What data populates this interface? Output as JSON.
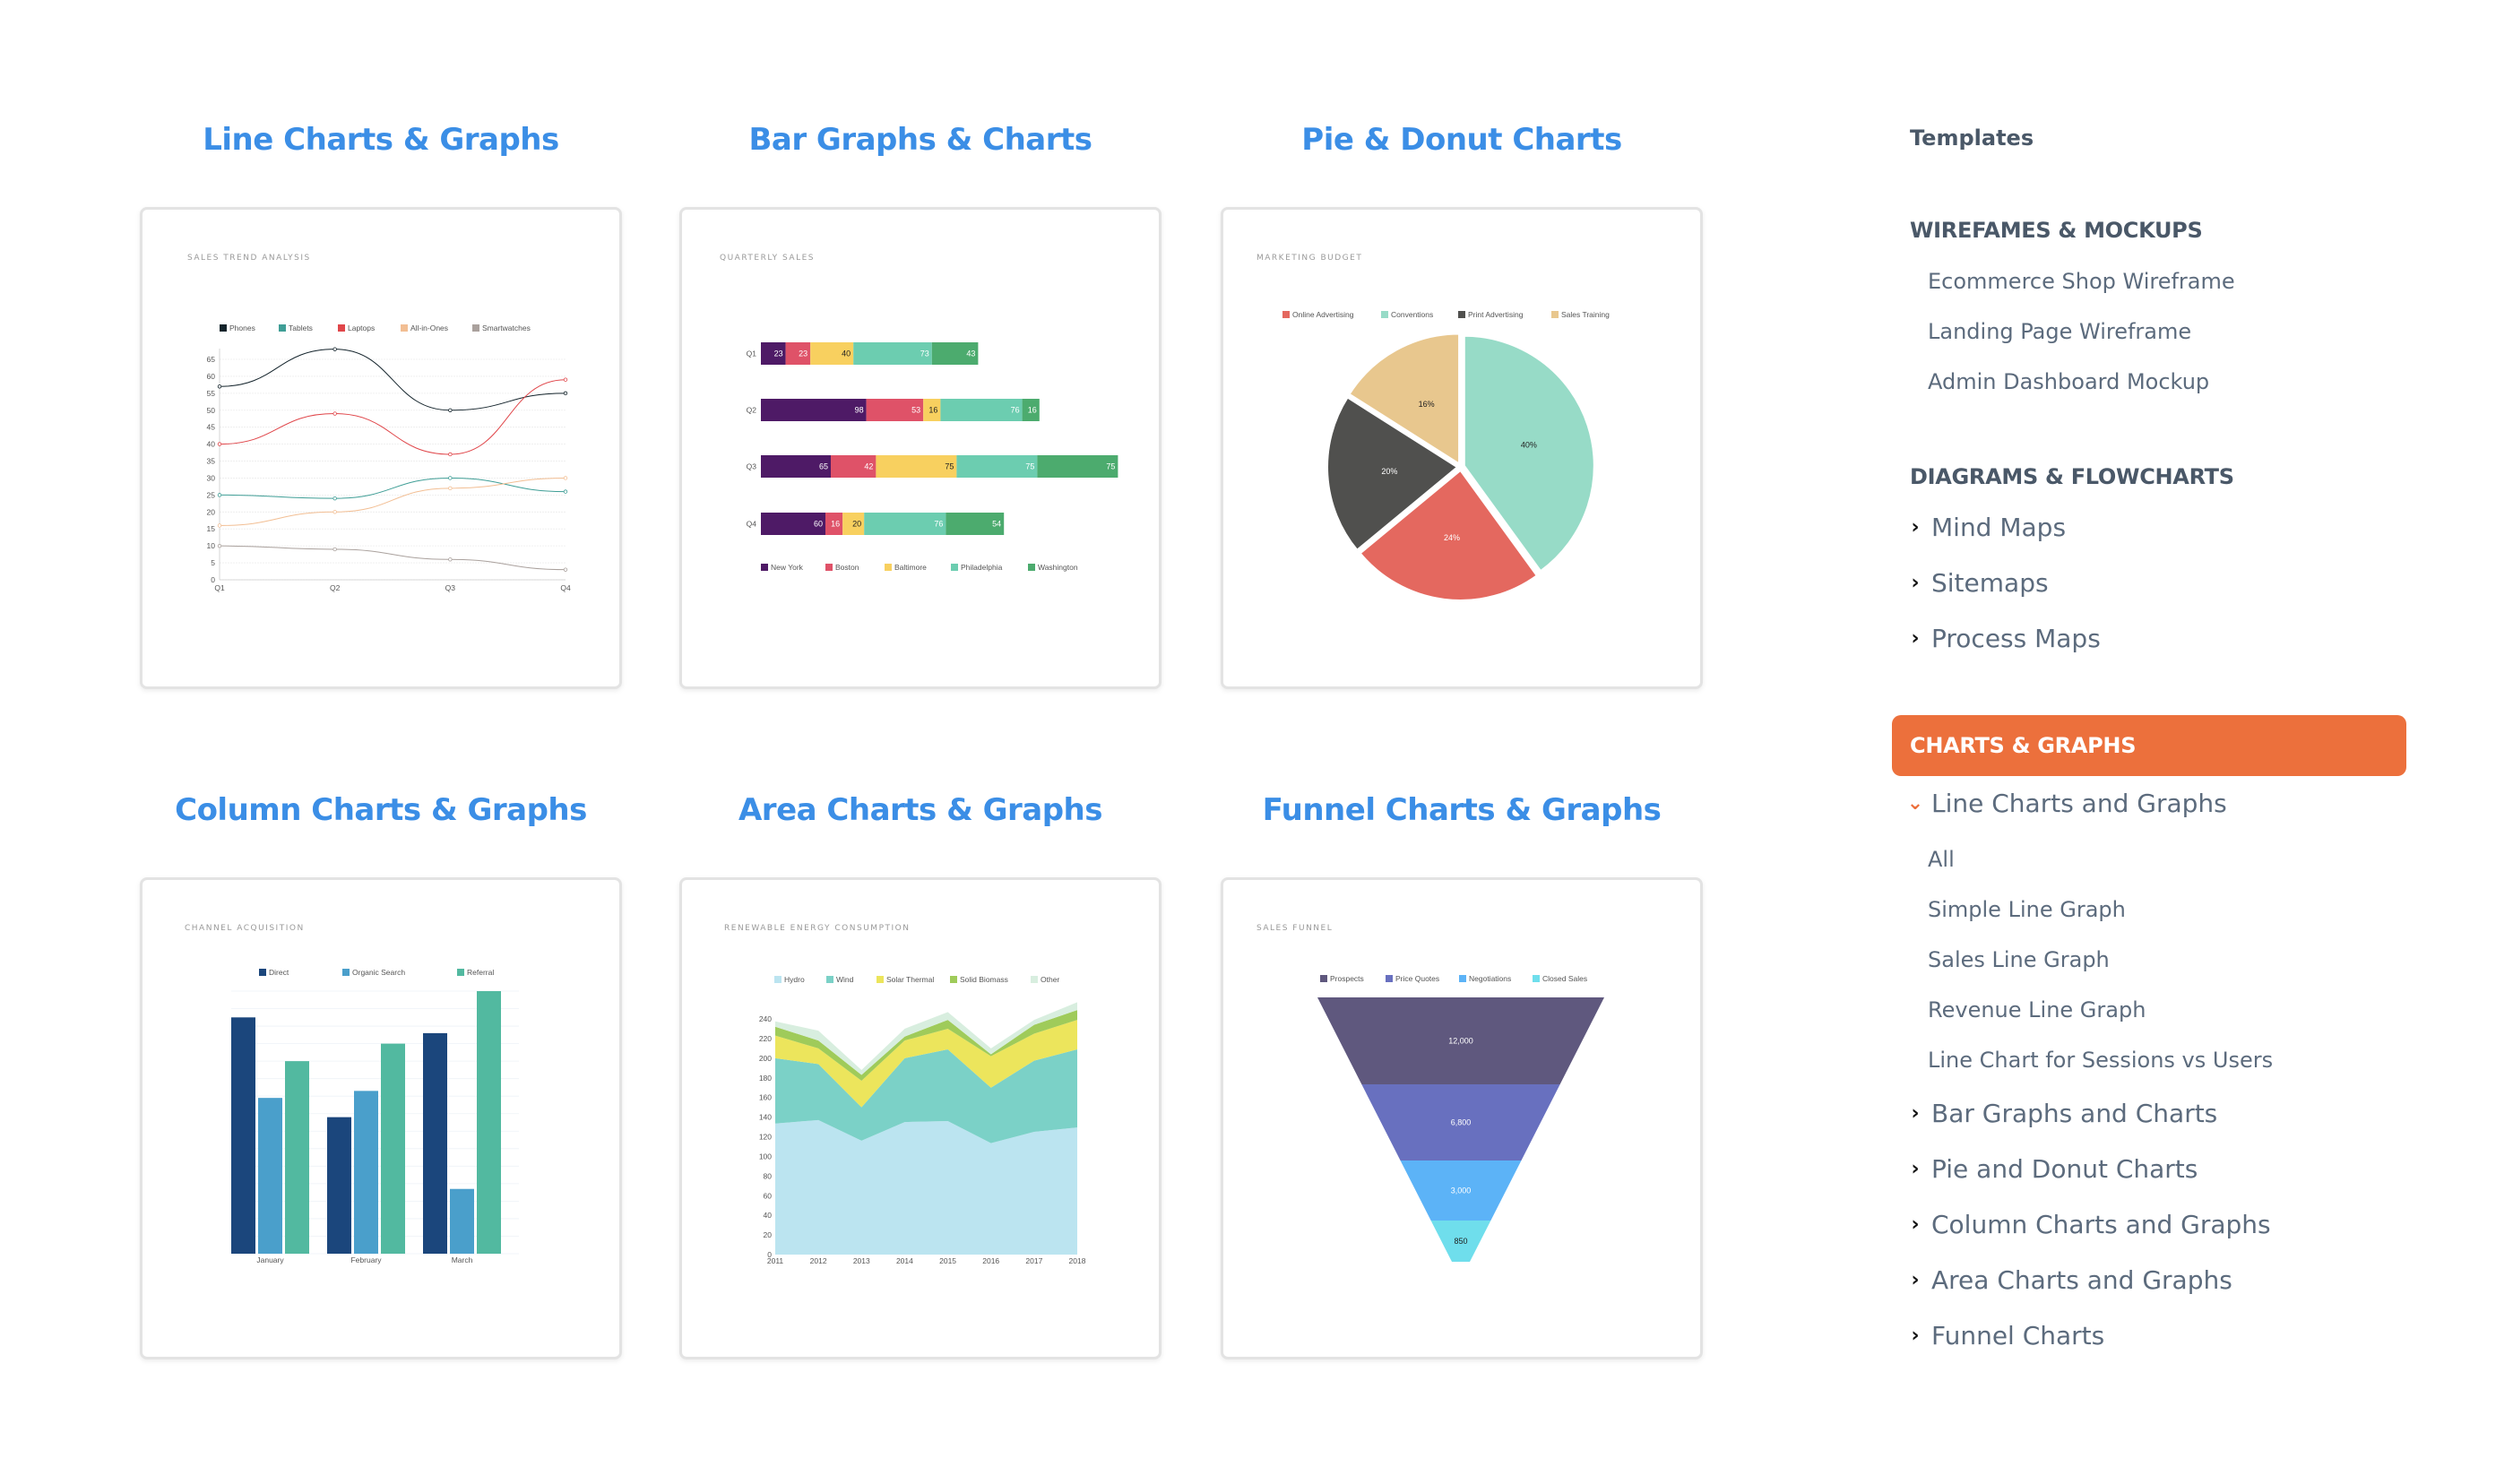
{
  "sections": [
    {
      "heading": "Line Charts & Graphs"
    },
    {
      "heading": "Bar Graphs & Charts"
    },
    {
      "heading": "Pie & Donut Charts"
    },
    {
      "heading": "Column Charts & Graphs"
    },
    {
      "heading": "Area Charts & Graphs"
    },
    {
      "heading": "Funnel Charts & Graphs"
    }
  ],
  "sidebar": {
    "templates_label": "Templates",
    "groups": [
      {
        "heading": "WIREFAMES & MOCKUPS",
        "items": [
          "Ecommerce Shop Wireframe",
          "Landing Page Wireframe",
          "Admin Dashboard Mockup"
        ]
      },
      {
        "heading": "DIAGRAMS & FLOWCHARTS",
        "items": [
          "Mind Maps",
          "Sitemaps",
          "Process Maps"
        ]
      }
    ],
    "active_category": "CHARTS & GRAPHS",
    "expanded_item": "Line Charts and Graphs",
    "expanded_subitems": [
      "All",
      "Simple Line Graph",
      "Sales Line Graph",
      "Revenue Line Graph",
      "Line Chart for Sessions vs Users"
    ],
    "collapsed_items": [
      "Bar Graphs and Charts",
      "Pie and Donut Charts",
      "Column Charts and Graphs",
      "Area Charts and Graphs",
      "Funnel Charts"
    ],
    "accent_color": "#ec703c",
    "heading_color": "#3b8ee6"
  },
  "chart_data": [
    {
      "type": "line",
      "title": "SALES TREND ANALYSIS",
      "categories": [
        "Q1",
        "Q2",
        "Q3",
        "Q4"
      ],
      "ylim": [
        0,
        65
      ],
      "yticks": [
        0,
        5,
        10,
        15,
        20,
        25,
        30,
        35,
        40,
        45,
        50,
        55,
        60,
        65
      ],
      "legend": "top",
      "grid": true,
      "series": [
        {
          "name": "Phones",
          "color": "#13232b",
          "values": [
            57,
            68,
            50,
            55
          ]
        },
        {
          "name": "Tablets",
          "color": "#3f9e96",
          "values": [
            25,
            24,
            30,
            26
          ]
        },
        {
          "name": "Laptops",
          "color": "#e0464a",
          "values": [
            40,
            49,
            37,
            59
          ]
        },
        {
          "name": "All-in-Ones",
          "color": "#f2be93",
          "values": [
            16,
            20,
            27,
            30
          ]
        },
        {
          "name": "Smartwatches",
          "color": "#aaa19d",
          "values": [
            10,
            9,
            6,
            3
          ]
        }
      ]
    },
    {
      "type": "bar",
      "orientation": "horizontal-stacked",
      "title": "QUARTERLY SALES",
      "categories": [
        "Q1",
        "Q2",
        "Q3",
        "Q4"
      ],
      "legend": "bottom",
      "series": [
        {
          "name": "New York",
          "color": "#4e1a66",
          "label_color": "#ffffff",
          "values": [
            23,
            98,
            65,
            60
          ]
        },
        {
          "name": "Boston",
          "color": "#df5268",
          "label_color": "#ffffff",
          "values": [
            23,
            53,
            42,
            16
          ]
        },
        {
          "name": "Baltimore",
          "color": "#f8d05f",
          "label_color": "#222222",
          "values": [
            40,
            16,
            75,
            20
          ]
        },
        {
          "name": "Philadelphia",
          "color": "#6ccdb0",
          "label_color": "#ffffff",
          "values": [
            73,
            76,
            75,
            76
          ]
        },
        {
          "name": "Washington",
          "color": "#4cab6e",
          "label_color": "#ffffff",
          "values": [
            43,
            16,
            75,
            54
          ]
        }
      ]
    },
    {
      "type": "pie",
      "title": "MARKETING BUDGET",
      "legend": "top",
      "slices": [
        {
          "name": "Conventions",
          "value": 40,
          "label": "40%",
          "color": "#97dbc7",
          "label_color": "#222222"
        },
        {
          "name": "Online Advertising",
          "value": 24,
          "label": "24%",
          "color": "#e4685f",
          "label_color": "#ffffff"
        },
        {
          "name": "Print Advertising",
          "value": 20,
          "label": "20%",
          "color": "#50504e",
          "label_color": "#ffffff"
        },
        {
          "name": "Sales Training",
          "value": 16,
          "label": "16%",
          "color": "#e8c78e",
          "label_color": "#222222"
        }
      ],
      "legend_order": [
        "Online Advertising",
        "Conventions",
        "Print Advertising",
        "Sales Training"
      ]
    },
    {
      "type": "bar",
      "orientation": "vertical-grouped",
      "title": "CHANNEL ACQUISITION",
      "categories": [
        "January",
        "February",
        "March"
      ],
      "ylim": [
        0,
        15
      ],
      "grid": true,
      "legend": "top",
      "series": [
        {
          "name": "Direct",
          "color": "#1b467c",
          "values": [
            13.5,
            7.8,
            12.6
          ]
        },
        {
          "name": "Organic Search",
          "color": "#4a9fcb",
          "values": [
            8.9,
            9.3,
            3.7
          ]
        },
        {
          "name": "Referral",
          "color": "#52b9a0",
          "values": [
            11,
            12,
            15
          ]
        }
      ]
    },
    {
      "type": "area",
      "stacked": true,
      "title": "RENEWABLE ENERGY CONSUMPTION",
      "x": [
        "2011",
        "2012",
        "2013",
        "2014",
        "2015",
        "2016",
        "2017",
        "2018"
      ],
      "ylim": [
        0,
        240
      ],
      "yticks": [
        0,
        20,
        40,
        60,
        80,
        100,
        120,
        140,
        160,
        180,
        200,
        220,
        240
      ],
      "legend": "top",
      "series": [
        {
          "name": "Hydro",
          "color": "#bbe4f0",
          "values": [
            133.5,
            137,
            116,
            135,
            136,
            113.5,
            125,
            129.5
          ]
        },
        {
          "name": "Wind",
          "color": "#7bd1c7",
          "values": [
            66.5,
            57,
            34,
            65,
            73,
            56.5,
            72.5,
            79.5
          ]
        },
        {
          "name": "Solar Thermal",
          "color": "#ece55c",
          "values": [
            23,
            16,
            27,
            18,
            21,
            32,
            27.5,
            30
          ]
        },
        {
          "name": "Solid Biomass",
          "color": "#9fcb5a",
          "values": [
            9,
            8,
            6,
            4,
            9,
            2,
            9,
            10
          ]
        },
        {
          "name": "Other",
          "color": "#d8eedf",
          "values": [
            5.5,
            10,
            5,
            8,
            8,
            6,
            5,
            8
          ]
        }
      ]
    },
    {
      "type": "funnel",
      "title": "SALES FUNNEL",
      "legend": "top",
      "stages": [
        {
          "name": "Prospects",
          "value": 12000,
          "label": "12,000",
          "color": "#5f587e",
          "label_color": "#ffffff"
        },
        {
          "name": "Price Quotes",
          "value": 6800,
          "label": "6,800",
          "color": "#6870bf",
          "label_color": "#ffffff"
        },
        {
          "name": "Negotiations",
          "value": 3000,
          "label": "3,000",
          "color": "#5cb3f7",
          "label_color": "#ffffff"
        },
        {
          "name": "Closed Sales",
          "value": 850,
          "label": "850",
          "color": "#6fdeec",
          "label_color": "#222222"
        }
      ]
    }
  ]
}
